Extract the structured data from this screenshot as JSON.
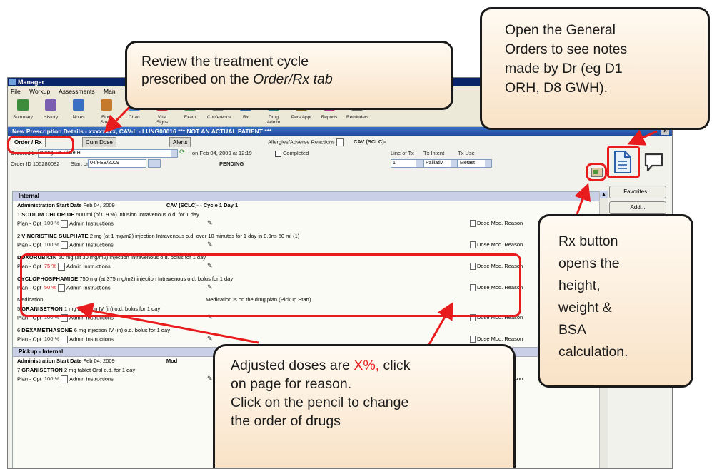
{
  "app": {
    "title": "Manager",
    "menu": [
      "File",
      "Workup",
      "Assessments",
      "Man"
    ],
    "toolbar": [
      {
        "label": "Summary",
        "color": "#3c8c3c"
      },
      {
        "label": "History",
        "color": "#7a5cb0"
      },
      {
        "label": "Notes",
        "color": "#3a6fc4"
      },
      {
        "label": "Flow Sheet",
        "color": "#c47a2a"
      },
      {
        "label": "Chart",
        "color": "#4a8fd0"
      },
      {
        "label": "Vital Signs",
        "color": "#c43a3a"
      },
      {
        "label": "Exam",
        "color": "#5a9a5a"
      },
      {
        "label": "Conference",
        "color": "#888888"
      },
      {
        "label": "Rx",
        "color": "#3a6fc4"
      },
      {
        "label": "Drug Admin",
        "color": "#2a8a8a"
      },
      {
        "label": "Pers Appt",
        "color": "#8a6a2a"
      },
      {
        "label": "Reports",
        "color": "#b03a8a"
      },
      {
        "label": "Reminders",
        "color": "#6a6a6a"
      }
    ]
  },
  "dialog": {
    "title": "New Prescription Details - xxxxxxxx, CAV-L - LUNG00016 *** NOT AN ACTUAL PATIENT ***",
    "tabs": [
      "Order / Rx",
      "Cum Dose",
      "Alerts"
    ],
    "allergies_label": "Allergies/Adverse Reactions",
    "regimen": "CAV (SCLC)-",
    "ordered_by_label": "Ordered by",
    "ordered_by": "Wong, Dr. Clare H",
    "ordered_on": "on Feb 04, 2009  at 12:19",
    "completed_label": "Completed",
    "order_id_label": "Order ID 105280082",
    "start_on_label": "Start on",
    "start_on": "04/FEB/2009",
    "status": "PENDING",
    "line_tx_label": "Line of Tx",
    "tx_intent_label": "Tx Intent",
    "tx_use_label": "Tx Use",
    "line_tx": "1",
    "tx_intent": "Palliativ",
    "tx_use": "Metast"
  },
  "orders": {
    "section1": "Internal",
    "admin_start_label": "Administration Start Date",
    "admin_start": "Feb 04, 2009",
    "cycle": "CAV (SCLC)- - Cycle 1 Day 1",
    "plan": "Plan - Opt",
    "admin_instr": "Admin Instructions",
    "dose_mod": "Dose Mod. Reason",
    "drugs": [
      {
        "num": "1",
        "name": "SODIUM CHLORIDE",
        "detail": "500 ml (of 0.9 %) infusion Intravenous o.d. for 1 day",
        "pct": "100 %"
      },
      {
        "num": "2",
        "name": "VINCRISTINE SULPHATE",
        "detail": "2 mg (at 1 mg/m2) injection Intravenous o.d. over 10 minutes for 1 day in 0.9ns 50 ml (1)",
        "pct": "100 %"
      },
      {
        "num": "",
        "name": "DOXORUBICIN",
        "detail": "60 mg (at 30 mg/m2) injection Intravenous o.d. bolus for 1 day",
        "pct": "75 %"
      },
      {
        "num": "",
        "name": "CYCLOPHOSPHAMIDE",
        "detail": "750 mg (at 375 mg/m2) injection Intravenous o.d. bolus for 1 day",
        "pct": "50 %"
      },
      {
        "num": "5",
        "name": "GRANISETRON",
        "detail": "1 mg injection IV (in) o.d. bolus for 1 day",
        "pct": "100 %"
      },
      {
        "num": "6",
        "name": "DEXAMETHASONE",
        "detail": "6 mg injection IV (in) o.d. bolus for 1 day",
        "pct": "100 %"
      }
    ],
    "note_row": "Medication",
    "note_text": "Medication is on the drug plan (Pickup Start)",
    "section2": "Pickup - Internal",
    "admin_start2": "Feb 04, 2009",
    "mod_label": "Mod",
    "drug7": {
      "num": "7",
      "name": "GRANISETRON",
      "detail": "2 mg tablet Oral o.d. for 1 day",
      "pct": "100 %"
    }
  },
  "side_buttons": [
    "Favorites...",
    "Add..."
  ],
  "callouts": {
    "review": [
      "Review the treatment cycle",
      "prescribed on the ",
      "Order/Rx tab"
    ],
    "general": [
      "Open the General",
      "Orders to see notes",
      "made by Dr (eg D1",
      "ORH, D8 GWH)."
    ],
    "rx": [
      "Rx button",
      "opens the",
      "height,",
      "weight &",
      "BSA",
      "calculation."
    ],
    "adjusted": [
      "Adjusted doses are ",
      "X%,",
      " click",
      "on page for reason.",
      "Click on the pencil to change",
      "the order of drugs"
    ]
  },
  "colors": {
    "annotation_red": "#e81c1c",
    "adjusted_red": "#e02020",
    "callout_fill": "#f9e2c6"
  }
}
